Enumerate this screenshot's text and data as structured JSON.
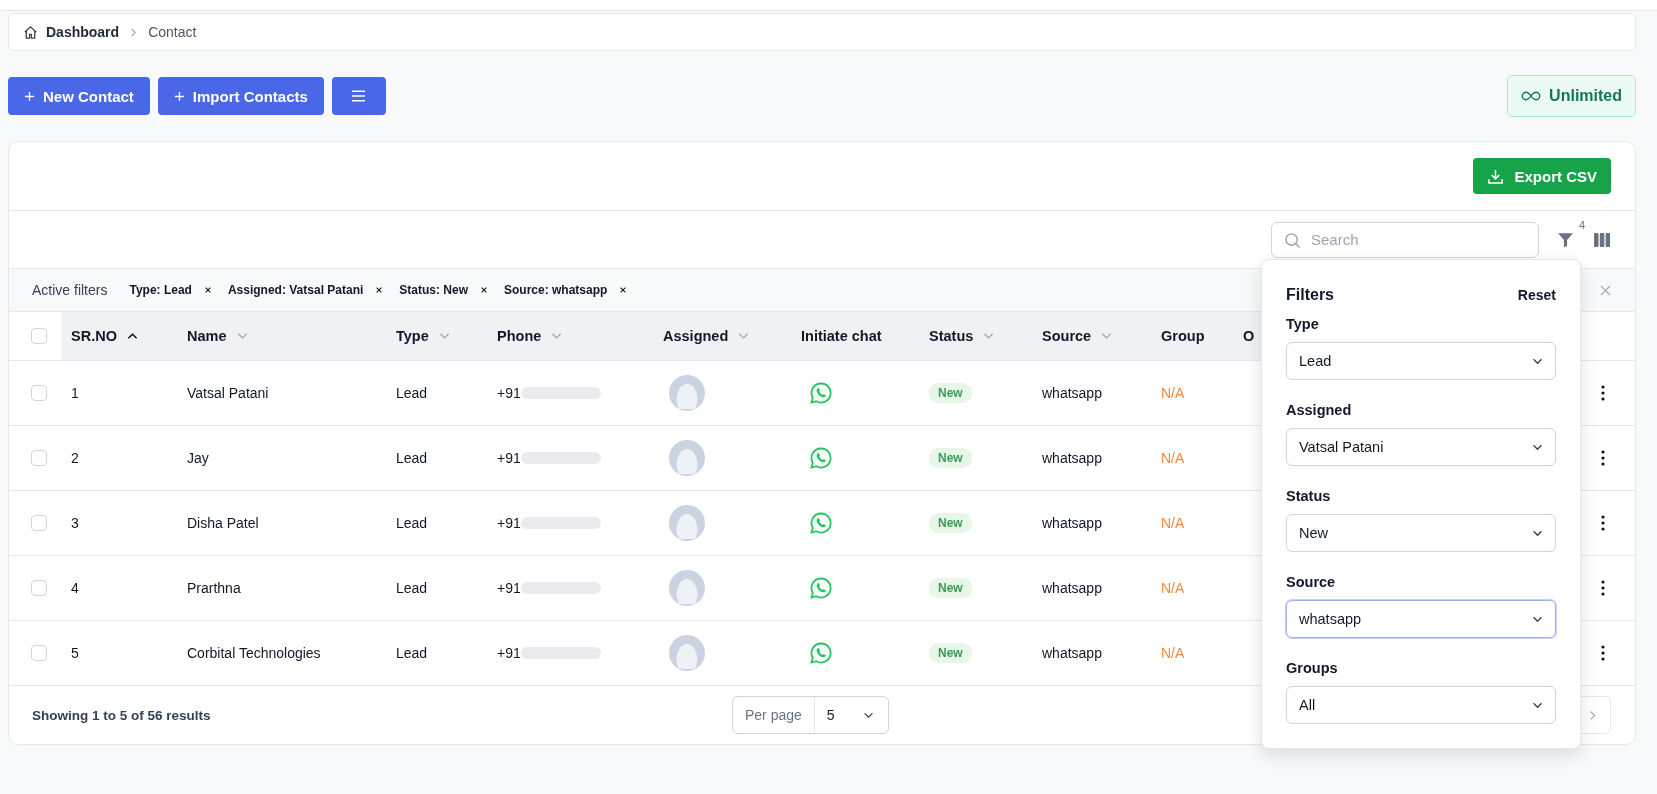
{
  "breadcrumb": [
    {
      "label": "Dashboard",
      "kind": "home"
    },
    {
      "label": "Contact",
      "kind": "current"
    }
  ],
  "actions": [
    {
      "label": "New Contact",
      "kind": "add"
    },
    {
      "label": "Import Contacts",
      "kind": "add"
    },
    {
      "kind": "menu"
    }
  ],
  "plan_badge": {
    "label": "Unlimited"
  },
  "export_button": {
    "label": "Export CSV"
  },
  "search": {
    "placeholder": "Search"
  },
  "filter_count": "4",
  "active_filters": {
    "label": "Active filters",
    "chips": [
      "Type: Lead",
      "Assigned: Vatsal Patani",
      "Status: New",
      "Source: whatsapp"
    ]
  },
  "table": {
    "all_selected": false,
    "columns": [
      {
        "label": "SR.NO",
        "sorted": true
      },
      {
        "label": "Name",
        "sorted": false
      },
      {
        "label": "Type",
        "sorted": false
      },
      {
        "label": "Phone",
        "sorted": false
      },
      {
        "label": "Assigned",
        "sorted": false
      },
      {
        "label": "Initiate chat"
      },
      {
        "label": "Status",
        "sorted": false
      },
      {
        "label": "Source",
        "sorted": false
      },
      {
        "label": "Group"
      },
      {
        "label": "O"
      }
    ],
    "rows": [
      {
        "selected": false,
        "sr": "1",
        "name": "Vatsal Patani",
        "type": "Lead",
        "phone": "+91",
        "status": "New",
        "source": "whatsapp",
        "group": "N/A"
      },
      {
        "selected": false,
        "sr": "2",
        "name": "Jay",
        "type": "Lead",
        "phone": "+91",
        "status": "New",
        "source": "whatsapp",
        "group": "N/A"
      },
      {
        "selected": false,
        "sr": "3",
        "name": "Disha Patel",
        "type": "Lead",
        "phone": "+91",
        "status": "New",
        "source": "whatsapp",
        "group": "N/A"
      },
      {
        "selected": false,
        "sr": "4",
        "name": "Prarthna",
        "type": "Lead",
        "phone": "+91",
        "status": "New",
        "source": "whatsapp",
        "group": "N/A"
      },
      {
        "selected": false,
        "sr": "5",
        "name": "Corbital Technologies",
        "type": "Lead",
        "phone": "+91",
        "status": "New",
        "source": "whatsapp",
        "group": "N/A"
      }
    ]
  },
  "footer": {
    "summary": "Showing 1 to 5 of 56 results",
    "per_page_label": "Per page",
    "per_page": "5"
  },
  "filters_panel": {
    "title": "Filters",
    "reset": "Reset",
    "fields": [
      {
        "label": "Type",
        "value": "Lead",
        "focused": false
      },
      {
        "label": "Assigned",
        "value": "Vatsal Patani",
        "focused": false
      },
      {
        "label": "Status",
        "value": "New",
        "focused": false
      },
      {
        "label": "Source",
        "value": "whatsapp",
        "focused": true
      },
      {
        "label": "Groups",
        "value": "All",
        "focused": false
      }
    ]
  }
}
